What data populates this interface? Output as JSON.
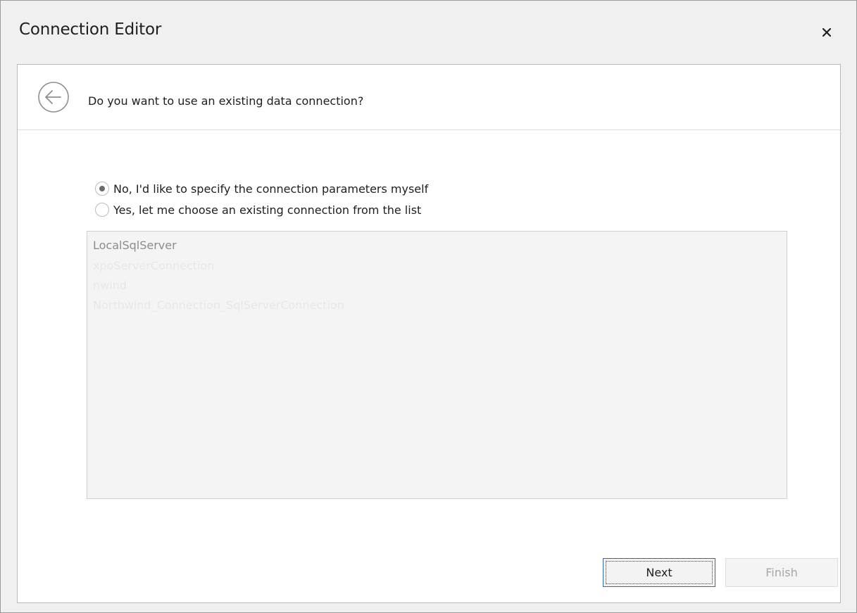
{
  "window": {
    "title": "Connection Editor",
    "close_icon": "close-icon"
  },
  "header": {
    "back_icon": "back-arrow-icon",
    "question": "Do you want to use an existing data connection?"
  },
  "options": [
    {
      "label": "No, I'd like to specify the connection parameters myself",
      "checked": true
    },
    {
      "label": "Yes, let me choose an existing connection from the list",
      "checked": false
    }
  ],
  "connections": {
    "enabled": false,
    "items": [
      "LocalSqlServer",
      "xpoServerConnection",
      "nwind",
      "Northwind_Connection_SqlServerConnection"
    ]
  },
  "buttons": {
    "next": "Next",
    "finish": "Finish",
    "finish_enabled": false
  },
  "colors": {
    "accent_border": "#2e6ac6",
    "window_bg": "#f0f0f0"
  }
}
